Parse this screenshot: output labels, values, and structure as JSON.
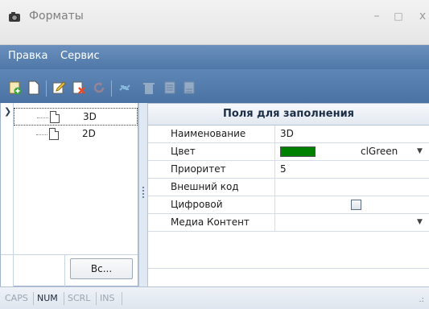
{
  "window": {
    "title": "Форматы"
  },
  "menu": {
    "items": [
      "Правка",
      "Сервис"
    ]
  },
  "toolbar": {
    "icons": [
      "add-icon",
      "new-document-icon",
      "edit-icon",
      "delete-icon",
      "refresh-icon",
      "convert-icon",
      "trash-icon",
      "move-up-icon",
      "move-down-icon"
    ]
  },
  "tree": {
    "items": [
      {
        "label": "3D"
      },
      {
        "label": "2D"
      }
    ],
    "all_button": "Вс..."
  },
  "grid": {
    "header": "Поля для заполнения",
    "rows": [
      {
        "name": "Наименование",
        "value": "3D"
      },
      {
        "name": "Цвет",
        "value": "clGreen"
      },
      {
        "name": "Приоритет",
        "value": "5"
      },
      {
        "name": "Внешний код",
        "value": ""
      },
      {
        "name": "Цифровой",
        "value": ""
      },
      {
        "name": "Медиа Контент",
        "value": ""
      }
    ],
    "color_swatch": "#008000",
    "digital_checked": false
  },
  "status": {
    "caps": "CAPS",
    "num": "NUM",
    "scrl": "SCRL",
    "ins": "INS"
  },
  "colors": {
    "menu_bg": "#5a82b2",
    "swatch": "#008000"
  }
}
